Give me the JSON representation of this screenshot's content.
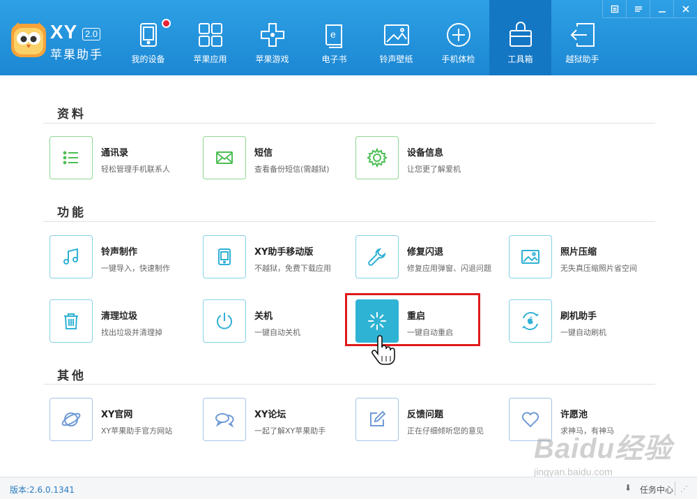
{
  "app": {
    "brand": "XY",
    "version": "2.0",
    "name": "苹果助手"
  },
  "nav": [
    {
      "label": "我的设备",
      "icon": "tablet-icon",
      "badge": true
    },
    {
      "label": "苹果应用",
      "icon": "apps-grid-icon"
    },
    {
      "label": "苹果游戏",
      "icon": "gamepad-icon"
    },
    {
      "label": "电子书",
      "icon": "ebook-icon"
    },
    {
      "label": "铃声壁纸",
      "icon": "wallpaper-icon"
    },
    {
      "label": "手机体检",
      "icon": "checkup-icon"
    },
    {
      "label": "工具箱",
      "icon": "toolbox-icon",
      "active": true
    },
    {
      "label": "越狱助手",
      "icon": "jailbreak-icon"
    }
  ],
  "sections": [
    {
      "title": "资料"
    },
    {
      "title": "功能"
    },
    {
      "title": "其他"
    }
  ],
  "tools": {
    "contacts": {
      "title": "通讯录",
      "desc": "轻松管理手机联系人"
    },
    "sms": {
      "title": "短信",
      "desc": "查看备份短信(需越狱)"
    },
    "device_info": {
      "title": "设备信息",
      "desc": "让您更了解爱机"
    },
    "ringtone": {
      "title": "铃声制作",
      "desc": "一键导入，快速制作"
    },
    "mobile": {
      "title": "XY助手移动版",
      "desc": "不越狱，免费下载应用"
    },
    "repair": {
      "title": "修复闪退",
      "desc": "修复应用弹窗、闪退问题"
    },
    "photo": {
      "title": "照片压缩",
      "desc": "无失真压缩照片省空间"
    },
    "clean": {
      "title": "清理垃圾",
      "desc": "找出垃圾并清理掉"
    },
    "shutdown": {
      "title": "关机",
      "desc": "一键自动关机"
    },
    "reboot": {
      "title": "重启",
      "desc": "一键自动重启"
    },
    "flash": {
      "title": "刷机助手",
      "desc": "一键自动刷机"
    },
    "website": {
      "title": "XY官网",
      "desc": "XY苹果助手官方网站"
    },
    "forum": {
      "title": "XY论坛",
      "desc": "一起了解XY苹果助手"
    },
    "feedback": {
      "title": "反馈问题",
      "desc": "正在仔细倾听您的意见"
    },
    "wish": {
      "title": "许愿池",
      "desc": "求神马，有神马"
    }
  },
  "footer": {
    "version": "版本:2.6.0.1341",
    "task_center": "任务中心"
  },
  "watermark": {
    "text": "Baidu经验",
    "url": "jingyan.baidu.com"
  },
  "colors": {
    "header": "#1c87d3",
    "green_border": "#8dd88f",
    "cyan_border": "#85d1e8",
    "selected": "#2fb3d4",
    "highlight": "#e01a1a"
  }
}
